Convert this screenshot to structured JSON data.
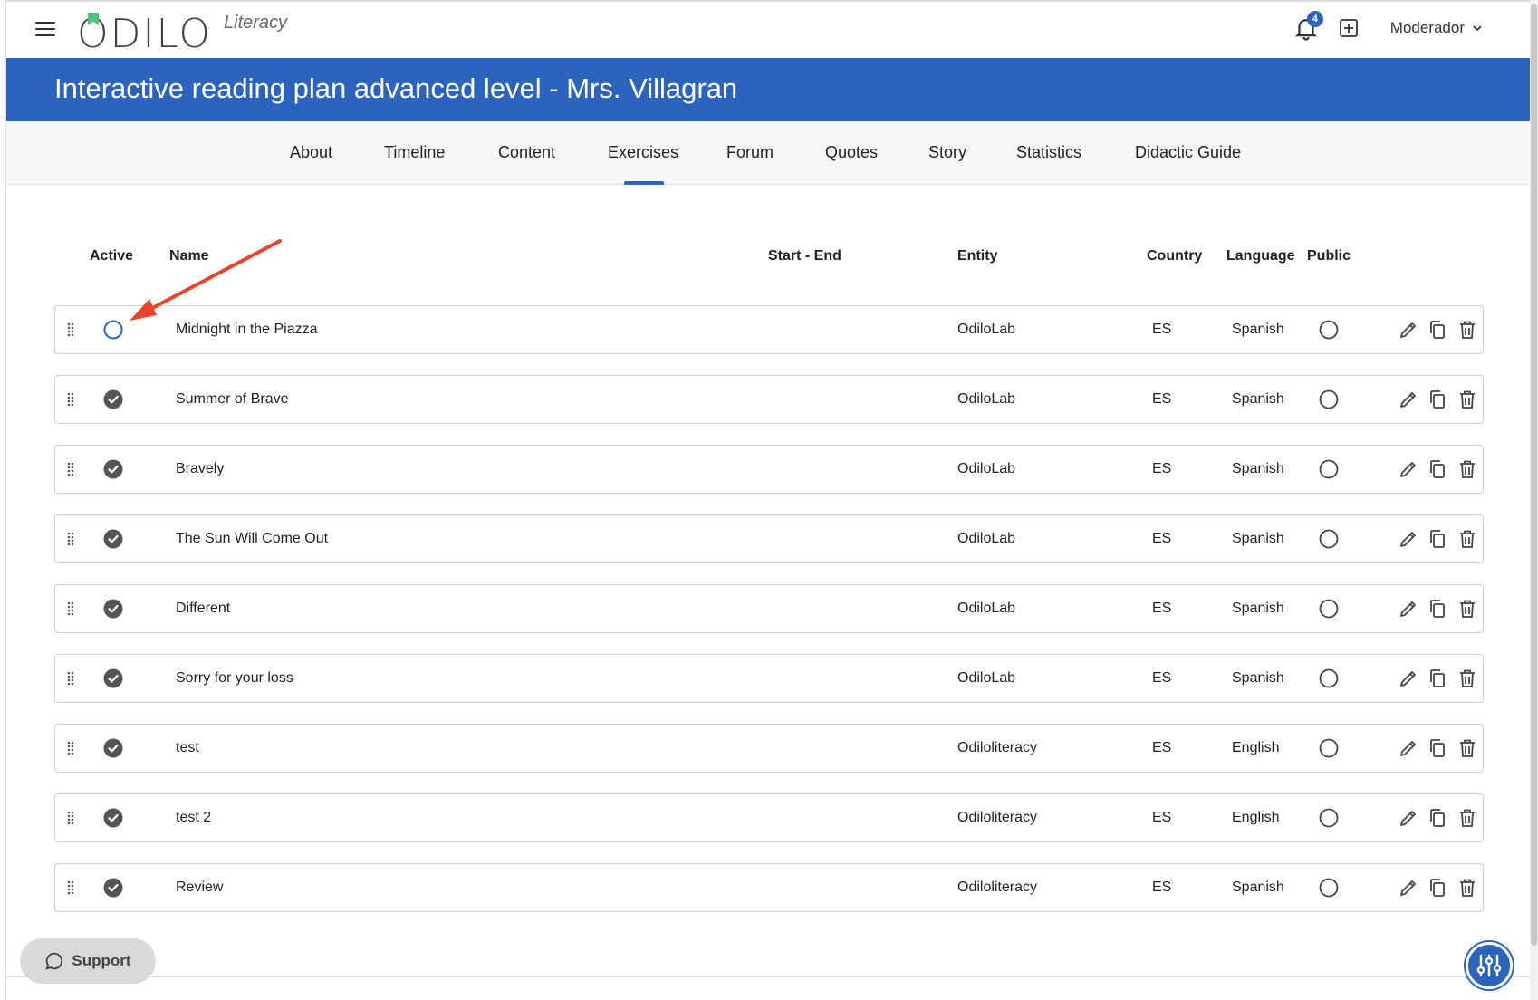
{
  "header": {
    "logo_text": "ODILO",
    "logo_sub": "Literacy",
    "notification_count": "4",
    "user_label": "Moderador",
    "icons": [
      "hamburger-menu-icon",
      "bell-icon",
      "add-box-icon",
      "chevron-down-icon"
    ]
  },
  "banner": {
    "title": "Interactive reading plan advanced level - Mrs. Villagran"
  },
  "tabs": [
    {
      "label": "About"
    },
    {
      "label": "Timeline"
    },
    {
      "label": "Content"
    },
    {
      "label": "Exercises",
      "active": true
    },
    {
      "label": "Forum"
    },
    {
      "label": "Quotes"
    },
    {
      "label": "Story"
    },
    {
      "label": "Statistics"
    },
    {
      "label": "Didactic Guide"
    }
  ],
  "table": {
    "headers": {
      "active": "Active",
      "name": "Name",
      "start_end": "Start - End",
      "entity": "Entity",
      "country": "Country",
      "language": "Language",
      "public": "Public"
    },
    "rows": [
      {
        "active": false,
        "name": "Midnight in the Piazza",
        "entity": "OdiloLab",
        "country": "ES",
        "language": "Spanish",
        "public": false
      },
      {
        "active": true,
        "name": "Summer of Brave",
        "entity": "OdiloLab",
        "country": "ES",
        "language": "Spanish",
        "public": false
      },
      {
        "active": true,
        "name": "Bravely",
        "entity": "OdiloLab",
        "country": "ES",
        "language": "Spanish",
        "public": false
      },
      {
        "active": true,
        "name": "The Sun Will Come Out",
        "entity": "OdiloLab",
        "country": "ES",
        "language": "Spanish",
        "public": false
      },
      {
        "active": true,
        "name": "Different",
        "entity": "OdiloLab",
        "country": "ES",
        "language": "Spanish",
        "public": false
      },
      {
        "active": true,
        "name": "Sorry for your loss",
        "entity": "OdiloLab",
        "country": "ES",
        "language": "Spanish",
        "public": false
      },
      {
        "active": true,
        "name": "test",
        "entity": "Odiloliteracy",
        "country": "ES",
        "language": "English",
        "public": false
      },
      {
        "active": true,
        "name": "test 2",
        "entity": "Odiloliteracy",
        "country": "ES",
        "language": "English",
        "public": false
      },
      {
        "active": true,
        "name": "Review",
        "entity": "Odiloliteracy",
        "country": "ES",
        "language": "Spanish",
        "public": false
      }
    ],
    "row_actions": [
      "edit-pencil-icon",
      "duplicate-icon",
      "trash-icon"
    ]
  },
  "support": {
    "label": "Support"
  },
  "colors": {
    "primary": "#2b63bd",
    "annotation_arrow": "#e8442a",
    "check_fill": "#555555"
  }
}
